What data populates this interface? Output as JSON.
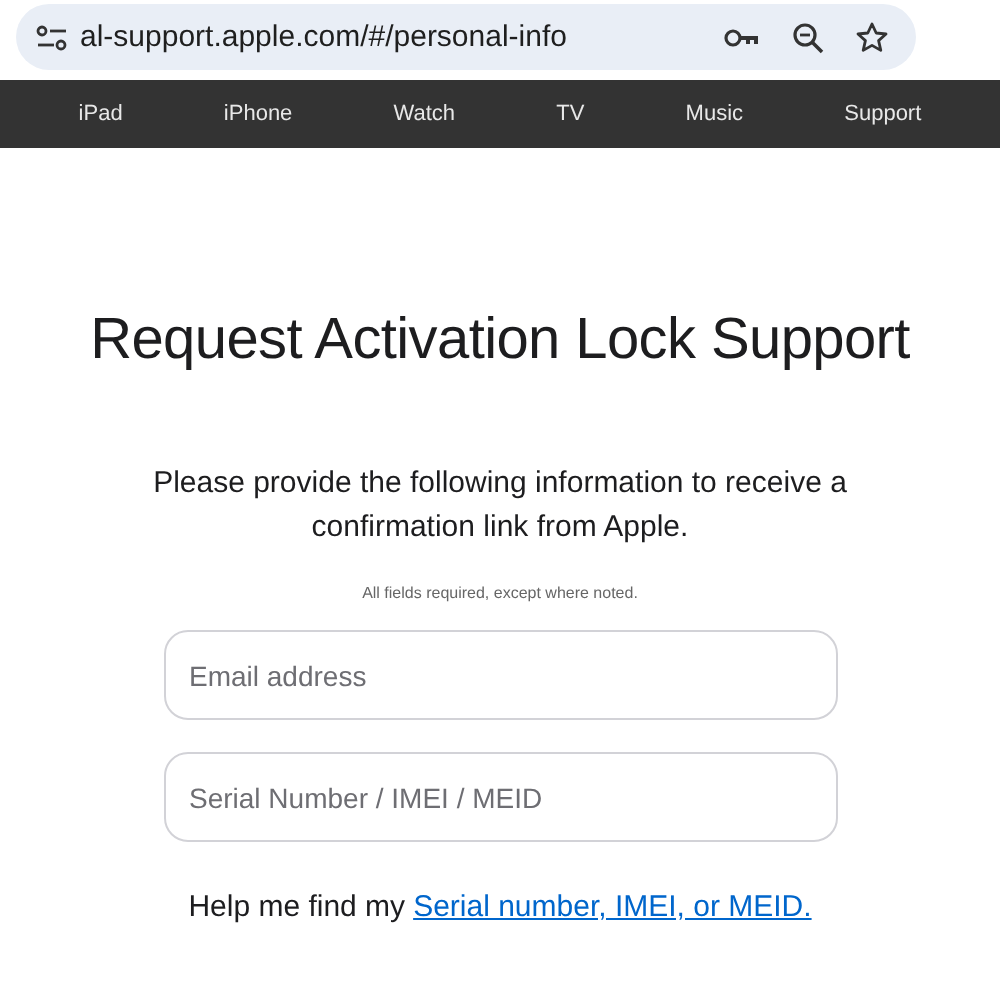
{
  "browser": {
    "url": "al-support.apple.com/#/personal-info"
  },
  "nav": {
    "items": [
      "iPad",
      "iPhone",
      "Watch",
      "TV",
      "Music",
      "Support"
    ]
  },
  "page": {
    "title": "Request Activation Lock Support",
    "intro": "Please provide the following information to receive a confirmation link from Apple.",
    "note": "All fields required, except where noted.",
    "fields": [
      {
        "placeholder": "Email address"
      },
      {
        "placeholder": "Serial Number / IMEI / MEID"
      }
    ],
    "help": {
      "text": "Help me find my",
      "link": "Serial number, IMEI, or MEID."
    }
  }
}
